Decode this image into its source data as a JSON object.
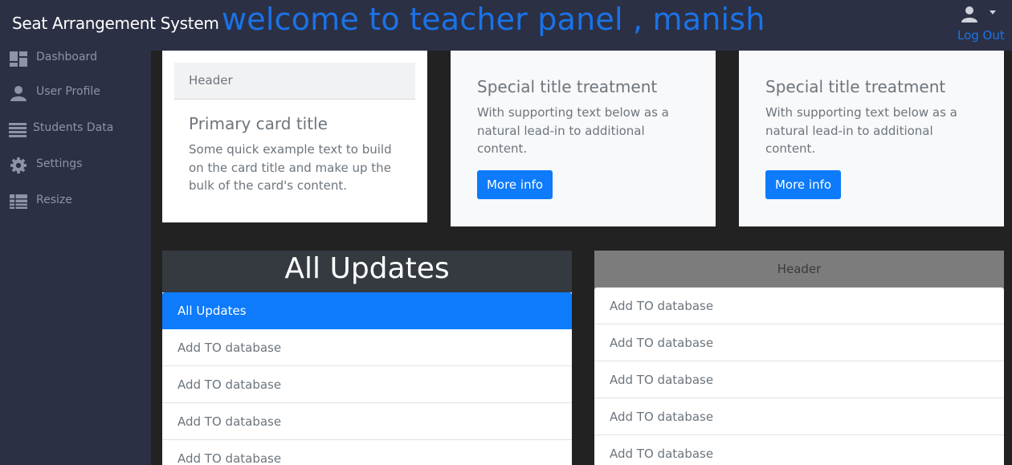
{
  "header": {
    "brand": "Seat Arrangement System",
    "welcome": "welcome to teacher panel , manish",
    "logout_label": "Log Out",
    "accent_color": "#1a73e8"
  },
  "sidebar": {
    "items": [
      {
        "label": "Dashboard",
        "icon": "dashboard-icon"
      },
      {
        "label": "User Profile",
        "icon": "user-icon"
      },
      {
        "label": "Students Data",
        "icon": "list-icon"
      },
      {
        "label": "Settings",
        "icon": "gear-icon"
      },
      {
        "label": "Resize",
        "icon": "table-icon"
      }
    ]
  },
  "cards": {
    "primary": {
      "header": "Header",
      "title": "Primary card title",
      "text_lines": [
        "Some quick example text to build",
        "on the card title and make up the",
        "bulk of the card's content."
      ]
    },
    "special_1": {
      "title": "Special title treatment",
      "text_lines": [
        "With supporting text below as a",
        "natural lead-in to additional",
        "content."
      ],
      "button_label": "More info"
    },
    "special_2": {
      "title": "Special title treatment",
      "text_lines": [
        "With supporting text below as a",
        "natural lead-in to additional",
        "content."
      ],
      "button_label": "More info"
    }
  },
  "updates": {
    "title": "All Updates",
    "items": [
      "All Updates",
      "Add TO database",
      "Add TO database",
      "Add TO database",
      "Add TO database"
    ]
  },
  "panel": {
    "header": "Header",
    "items": [
      "Add TO database",
      "Add TO database",
      "Add TO database",
      "Add TO database",
      "Add TO database"
    ]
  }
}
